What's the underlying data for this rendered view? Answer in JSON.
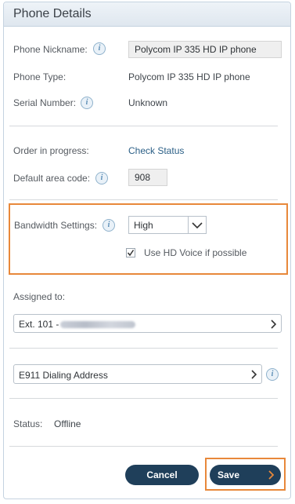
{
  "panel": {
    "title": "Phone Details"
  },
  "phone": {
    "nickname_label": "Phone Nickname:",
    "nickname_value": "Polycom IP 335 HD IP phone",
    "type_label": "Phone Type:",
    "type_value": "Polycom IP 335 HD IP phone",
    "serial_label": "Serial Number:",
    "serial_value": "Unknown"
  },
  "order": {
    "label": "Order in progress:",
    "link": "Check Status",
    "area_code_label": "Default area code:",
    "area_code_value": "908"
  },
  "bandwidth": {
    "label": "Bandwidth Settings:",
    "selected": "High",
    "hd_voice_label": "Use HD Voice if possible",
    "hd_voice_checked": true
  },
  "assigned": {
    "label": "Assigned to:",
    "extension_prefix": "Ext. 101 -"
  },
  "e911": {
    "label": "E911 Dialing Address"
  },
  "status": {
    "label": "Status:",
    "value": "Offline"
  },
  "buttons": {
    "cancel": "Cancel",
    "save": "Save"
  },
  "colors": {
    "accent_orange": "#e8883a",
    "button_navy": "#1f3f5a",
    "link": "#2b5f86"
  },
  "icons": [
    "info-icon",
    "chevron-down-icon",
    "chevron-right-icon",
    "checkmark-icon"
  ]
}
